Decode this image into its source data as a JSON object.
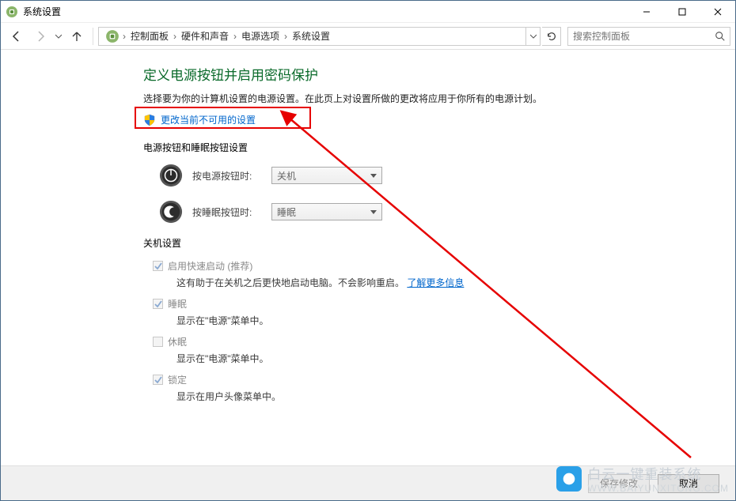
{
  "titlebar": {
    "title": "系统设置"
  },
  "breadcrumbs": {
    "segments": [
      "控制面板",
      "硬件和声音",
      "电源选项",
      "系统设置"
    ]
  },
  "search": {
    "placeholder": "搜索控制面板"
  },
  "heading": "定义电源按钮并启用密码保护",
  "description": "选择要为你的计算机设置的电源设置。在此页上对设置所做的更改将应用于你所有的电源计划。",
  "uac_link": "更改当前不可用的设置",
  "section_buttons": "电源按钮和睡眠按钮设置",
  "controls": {
    "power": {
      "label": "按电源按钮时:",
      "value": "关机"
    },
    "sleep": {
      "label": "按睡眠按钮时:",
      "value": "睡眠"
    }
  },
  "section_shutdown": "关机设置",
  "checkboxes": {
    "fastboot": {
      "label": "启用快速启动 (推荐)",
      "desc_a": "这有助于在关机之后更快地启动电脑。不会影响重启。",
      "link": "了解更多信息",
      "checked": true,
      "disabled": true
    },
    "sleep": {
      "label": "睡眠",
      "desc": "显示在\"电源\"菜单中。",
      "checked": true,
      "disabled": true
    },
    "hibernate": {
      "label": "休眠",
      "desc": "显示在\"电源\"菜单中。",
      "checked": false,
      "disabled": true
    },
    "lock": {
      "label": "锁定",
      "desc": "显示在用户头像菜单中。",
      "checked": true,
      "disabled": true
    }
  },
  "footer": {
    "save": "保存修改",
    "cancel": "取消"
  },
  "watermark": {
    "brand": "白云一键重装系统",
    "url": "WWW.BAIYUNXITONG.COM"
  }
}
